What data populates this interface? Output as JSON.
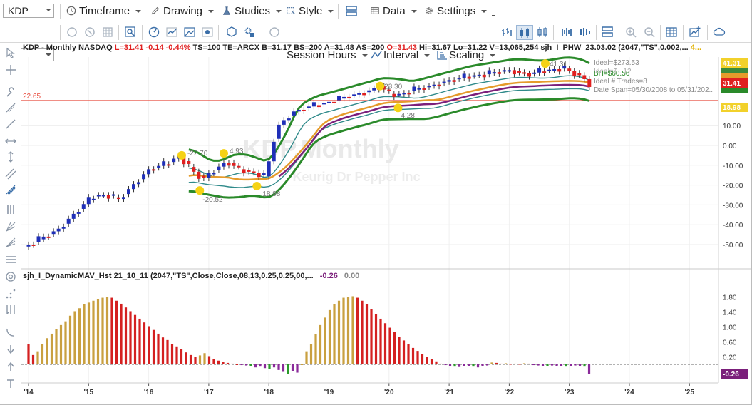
{
  "toolbar1": {
    "symbol": "KDP",
    "menus": [
      {
        "label": "Timeframe",
        "icon": "clock-icon"
      },
      {
        "label": "Drawing",
        "icon": "pencil-icon"
      },
      {
        "label": "Studies",
        "icon": "flask-icon"
      },
      {
        "label": "Style",
        "icon": "style-icon"
      },
      {
        "label": "Data",
        "icon": "data-grid-icon"
      },
      {
        "label": "Settings",
        "icon": "gear-icon"
      }
    ]
  },
  "toolbar2": {
    "menus": [
      {
        "label": "Session Hours"
      },
      {
        "label": "Interval"
      },
      {
        "label": "Scaling"
      }
    ]
  },
  "chart_header": {
    "pre": "KDP - Monthly  NASDAQ",
    "l": "L=31.41",
    "chg": "-0.14",
    "pct": "-0.44%",
    "rest1": "TS=100  TE=ARCX  B=31.17  BS=200  A=31.48  AS=200",
    "o": "O=31.43",
    "rest2": "Hi=31.67  Lo=31.22  V=13,065,254  sjh_I_PHW_23.03.02 (2047,\"TS\",0.002,...",
    "overflow": "4..."
  },
  "watermark": {
    "symbol": "KDP,Monthly",
    "name": "Keurig Dr Pepper Inc"
  },
  "chart_legend": {
    "ideal": "Ideal=$273.53",
    "ideal_frag": "Ideal=$...12",
    "bh": "BH=$60.56",
    "trades": "Ideal # Trades=8",
    "span": "Date Span=05/30/2008 to 05/31/202..."
  },
  "indicator_header": {
    "name": "sjh_I_DynamicMAV_Hst 21_10_11 (2047,\"TS\",Close,Close,08,13,0.25,0.25,00,...",
    "v1": "-0.26",
    "v2": "0.00"
  },
  "chart_data": {
    "type": "candlestick",
    "x_ticks": [
      "'14",
      "'15",
      "'16",
      "'17",
      "'18",
      "'19",
      "'20",
      "'21",
      "'22",
      "'23",
      "'24",
      "'25"
    ],
    "y_ticks_price": [
      "10.00",
      "0.00",
      "-10.00",
      "-20.00",
      "-30.00",
      "-40.00",
      "-50.00"
    ],
    "y_ticks_indicator": [
      "1.80",
      "1.40",
      "1.00",
      "0.60",
      "0.20"
    ],
    "hline_label": "22.65",
    "price_badges": [
      {
        "text": "41.31",
        "color": "#f2d12b"
      },
      {
        "text": "31.41",
        "color": "#e02020"
      },
      {
        "text": "18.98",
        "color": "#f2d12b"
      }
    ],
    "indicator_badge": {
      "text": "-0.26",
      "color": "#7b1f7b"
    },
    "pivot_labels": [
      "-22.70",
      "-20.52",
      "18.98",
      "4.93",
      "4.28",
      "23.30",
      "41.31"
    ],
    "indicator_values": [
      0.55,
      0.25,
      0.35,
      0.55,
      0.7,
      0.82,
      0.95,
      1.05,
      1.15,
      1.3,
      1.42,
      1.5,
      1.6,
      1.65,
      1.7,
      1.75,
      1.78,
      1.8,
      1.78,
      1.7,
      1.62,
      1.52,
      1.42,
      1.32,
      1.22,
      1.12,
      1.02,
      0.92,
      0.82,
      0.72,
      0.65,
      0.55,
      0.48,
      0.4,
      0.32,
      0.25,
      0.2,
      0.24,
      0.3,
      0.22,
      0.15,
      0.1,
      0.06,
      0.04,
      0.02,
      0.0,
      -0.02,
      -0.03,
      -0.05,
      -0.08,
      -0.06,
      -0.1,
      -0.12,
      -0.08,
      -0.15,
      -0.2,
      -0.25,
      -0.18,
      -0.22,
      0.0,
      0.35,
      0.55,
      0.8,
      1.05,
      1.25,
      1.45,
      1.6,
      1.7,
      1.78,
      1.8,
      1.82,
      1.78,
      1.7,
      1.6,
      1.48,
      1.35,
      1.22,
      1.1,
      0.98,
      0.86,
      0.74,
      0.64,
      0.54,
      0.44,
      0.36,
      0.28,
      0.2,
      0.14,
      0.08,
      0.02,
      -0.02,
      -0.04,
      -0.06,
      -0.07,
      -0.05,
      -0.04,
      -0.06,
      -0.08,
      -0.05,
      -0.03,
      0.05,
      0.04,
      0.02,
      0.03,
      0.01,
      0.02,
      0.01,
      0.03,
      0.02,
      -0.02,
      -0.03,
      -0.04,
      -0.05,
      -0.03,
      -0.04,
      -0.05,
      -0.06,
      -0.04,
      -0.03,
      -0.05,
      -0.06,
      -0.26
    ]
  }
}
